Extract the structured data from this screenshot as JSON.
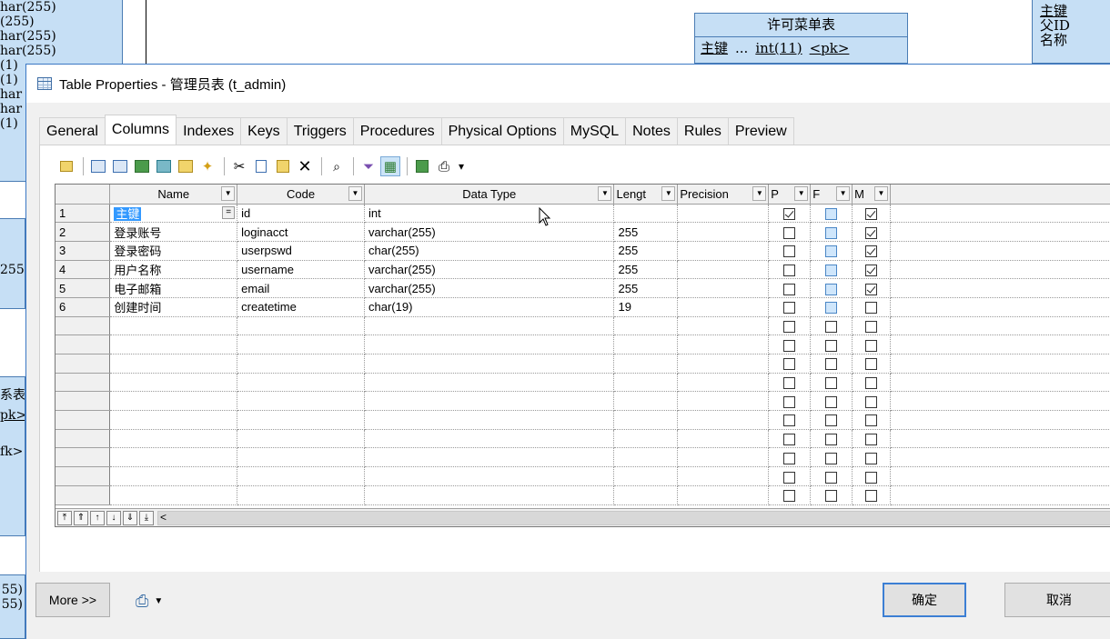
{
  "background": {
    "left_top_lines": [
      "har(255)",
      "(255)",
      "har(255)",
      "har(255)",
      "(1)",
      "(1)",
      "har",
      "har",
      "(1)"
    ],
    "left_box_1": [
      "255"
    ],
    "left_box_2": [
      "系表",
      "pk>",
      "fk>"
    ],
    "left_box_3": [
      "55)",
      "55)"
    ],
    "entity": {
      "title": "许可菜单表",
      "row_name": "主键",
      "row_dots": "...",
      "row_type": "int(11)",
      "row_key": "<pk>"
    },
    "right_box_lines": [
      "主键",
      "父ID",
      "名称"
    ]
  },
  "dialog": {
    "title": "Table Properties - 管理员表 (t_admin)",
    "tabs": [
      {
        "label": "General"
      },
      {
        "label": "Columns"
      },
      {
        "label": "Indexes"
      },
      {
        "label": "Keys"
      },
      {
        "label": "Triggers"
      },
      {
        "label": "Procedures"
      },
      {
        "label": "Physical Options"
      },
      {
        "label": "MySQL"
      },
      {
        "label": "Notes"
      },
      {
        "label": "Rules"
      },
      {
        "label": "Preview"
      }
    ],
    "active_tab": "Columns",
    "toolbar_dropdown_glyph": "▾",
    "grid": {
      "headers": {
        "name": "Name",
        "code": "Code",
        "data_type": "Data Type",
        "length": "Lengt",
        "precision": "Precision",
        "p": "P",
        "f": "F",
        "m": "M"
      },
      "header_dropdown_glyph": "▼",
      "rows": [
        {
          "num": "1",
          "name": "主键",
          "code": "id",
          "data_type": "int",
          "length": "",
          "precision": "",
          "p": true,
          "f": false,
          "m": true
        },
        {
          "num": "2",
          "name": "登录账号",
          "code": "loginacct",
          "data_type": "varchar(255)",
          "length": "255",
          "precision": "",
          "p": false,
          "f": false,
          "m": true
        },
        {
          "num": "3",
          "name": "登录密码",
          "code": "userpswd",
          "data_type": "char(255)",
          "length": "255",
          "precision": "",
          "p": false,
          "f": false,
          "m": true
        },
        {
          "num": "4",
          "name": "用户名称",
          "code": "username",
          "data_type": "varchar(255)",
          "length": "255",
          "precision": "",
          "p": false,
          "f": false,
          "m": true
        },
        {
          "num": "5",
          "name": "电子邮箱",
          "code": "email",
          "data_type": "varchar(255)",
          "length": "255",
          "precision": "",
          "p": false,
          "f": false,
          "m": true
        },
        {
          "num": "6",
          "name": "创建时间",
          "code": "createtime",
          "data_type": "char(19)",
          "length": "19",
          "precision": "",
          "p": false,
          "f": false,
          "m": false
        }
      ],
      "selected_cell_eq": "=",
      "empty_row_count": 10,
      "nav_buttons": [
        "⤒",
        "⇑",
        "↑",
        "↓",
        "⇓",
        "⤓"
      ],
      "scroll_left": "<"
    },
    "footer": {
      "more_label": "More >>",
      "ok_label": "确定",
      "cancel_label": "取消",
      "printer_dropdown": "▼"
    }
  }
}
